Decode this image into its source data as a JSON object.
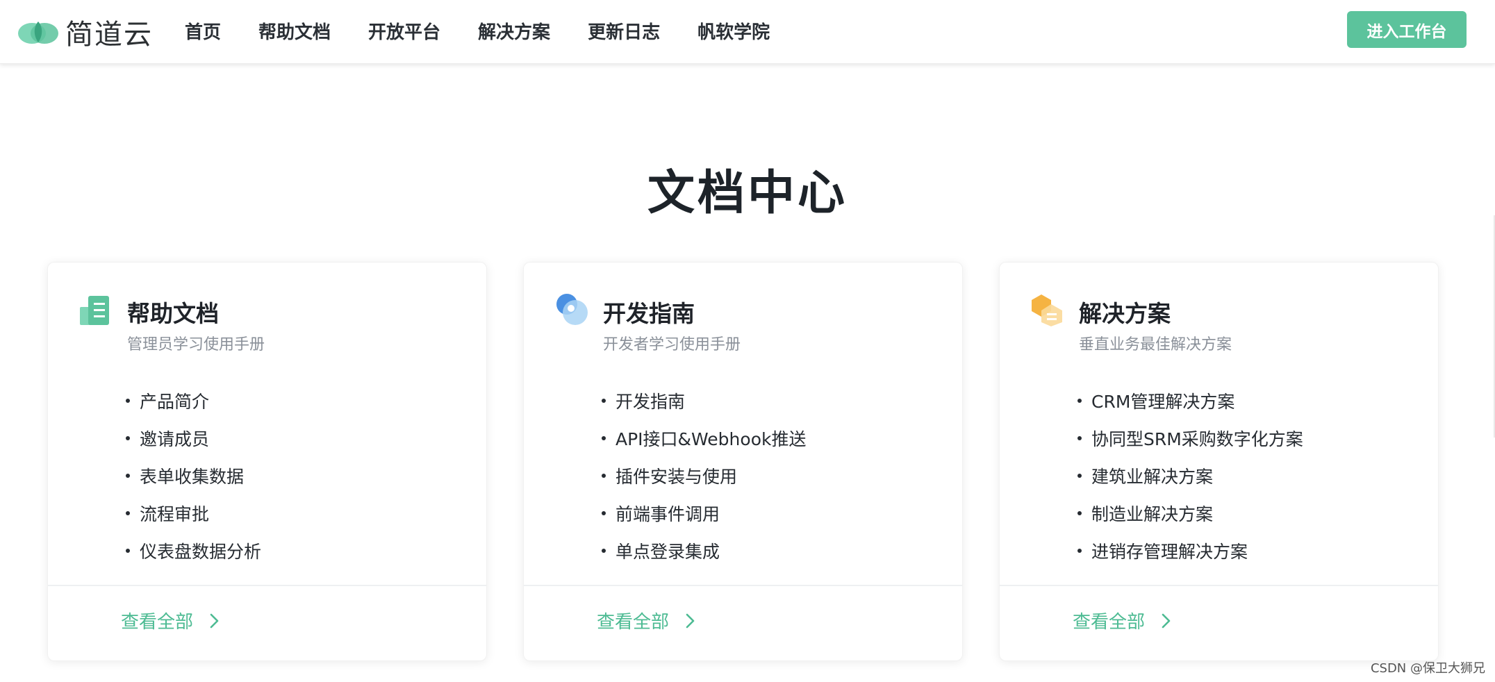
{
  "brand": {
    "name": "简道云",
    "accent": "#5cc39c"
  },
  "nav": {
    "items": [
      "首页",
      "帮助文档",
      "开放平台",
      "解决方案",
      "更新日志",
      "帆软学院"
    ],
    "cta": "进入工作台"
  },
  "page": {
    "title": "文档中心"
  },
  "cards": [
    {
      "icon": "document-icon",
      "title": "帮助文档",
      "subtitle": "管理员学习使用手册",
      "items": [
        "产品简介",
        "邀请成员",
        "表单收集数据",
        "流程审批",
        "仪表盘数据分析"
      ],
      "view_all": "查看全部"
    },
    {
      "icon": "developer-icon",
      "title": "开发指南",
      "subtitle": "开发者学习使用手册",
      "items": [
        "开发指南",
        "API接口&Webhook推送",
        "插件安装与使用",
        "前端事件调用",
        "单点登录集成"
      ],
      "view_all": "查看全部"
    },
    {
      "icon": "solution-icon",
      "title": "解决方案",
      "subtitle": "垂直业务最佳解决方案",
      "items": [
        "CRM管理解决方案",
        "协同型SRM采购数字化方案",
        "建筑业解决方案",
        "制造业解决方案",
        "进销存管理解决方案"
      ],
      "view_all": "查看全部"
    }
  ],
  "watermark": "CSDN @保卫大狮兄"
}
